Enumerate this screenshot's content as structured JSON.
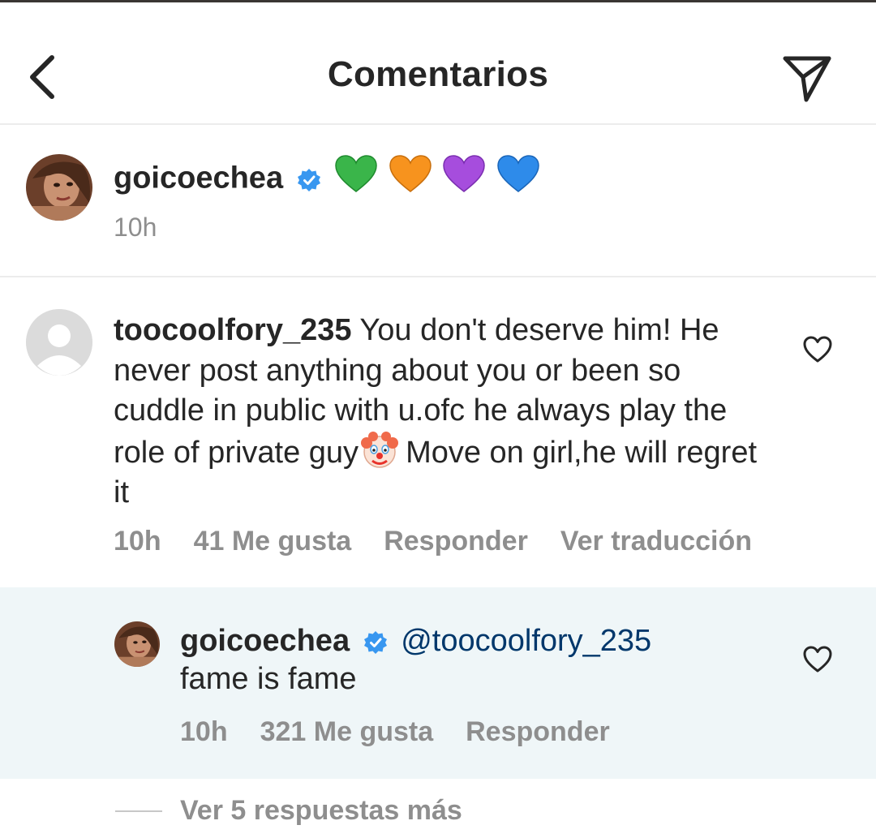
{
  "header": {
    "title": "Comentarios",
    "back_icon": "chevron-left-icon",
    "share_icon": "paper-plane-icon"
  },
  "caption": {
    "username": "goicoechea",
    "verified": true,
    "emojis": [
      "green-heart",
      "orange-heart",
      "purple-heart",
      "blue-heart"
    ],
    "time": "10h"
  },
  "comment": {
    "username": "toocoolfory_235",
    "text_part1": "You don't deserve him! He never post anything about you or been so cuddle in public with u.ofc he always play the role of private guy",
    "emoji": "clown-face",
    "text_part2": "Move on girl,he will regret it",
    "time": "10h",
    "likes": "41 Me gusta",
    "reply": "Responder",
    "translate": "Ver traducción"
  },
  "reply": {
    "username": "goicoechea",
    "verified": true,
    "mention": "@toocoolfory_235",
    "text": "fame is fame",
    "time": "10h",
    "likes": "321 Me gusta",
    "reply": "Responder"
  },
  "view_more": "Ver 5 respuestas más",
  "colors": {
    "text": "#262626",
    "secondary": "#8e8e8e",
    "verified": "#3897f0",
    "mention": "#00376b",
    "reply_bg": "#eff6f8"
  }
}
